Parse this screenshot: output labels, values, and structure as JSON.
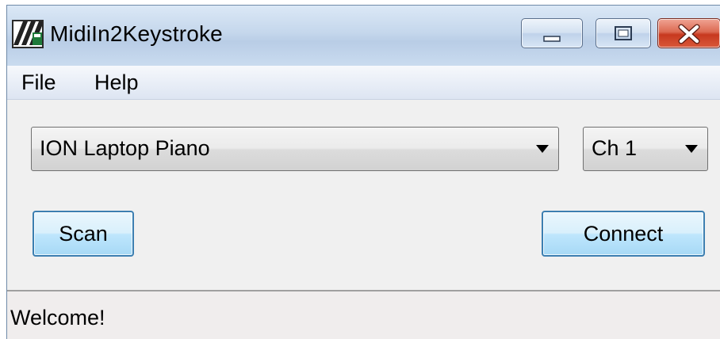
{
  "window": {
    "title": "MidiIn2Keystroke"
  },
  "menu": {
    "items": [
      {
        "label": "File"
      },
      {
        "label": "Help"
      }
    ]
  },
  "device_select": {
    "selected": "ION Laptop Piano"
  },
  "channel_select": {
    "selected": "Ch 1"
  },
  "buttons": {
    "scan_label": "Scan",
    "connect_label": "Connect"
  },
  "status": {
    "text": "Welcome!"
  },
  "icons": {
    "app": "piano-keys-icon",
    "minimize": "minimize-icon",
    "maximize": "maximize-icon",
    "close": "close-icon",
    "dropdown": "chevron-down-icon"
  },
  "colors": {
    "focus_button_border": "#3c7fb1",
    "close_button": "#c7391f"
  }
}
